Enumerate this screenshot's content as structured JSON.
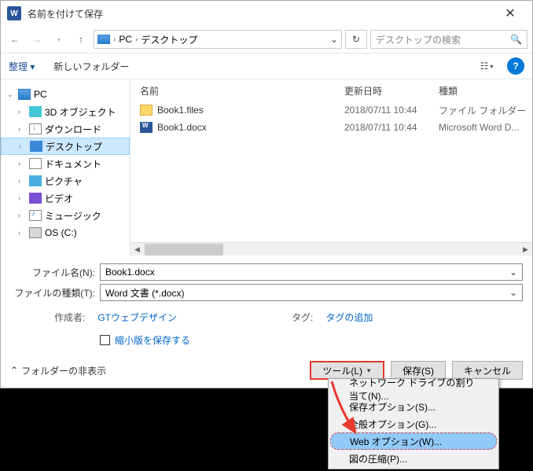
{
  "title": "名前を付けて保存",
  "breadcrumb": {
    "pc": "PC",
    "desktop": "デスクトップ"
  },
  "search": {
    "placeholder": "デスクトップの検索"
  },
  "toolbar": {
    "organize": "整理 ▾",
    "new_folder": "新しいフォルダー"
  },
  "columns": {
    "name": "名前",
    "date": "更新日時",
    "type": "種類"
  },
  "sidebar": {
    "pc": "PC",
    "items": [
      {
        "label": "3D オブジェクト"
      },
      {
        "label": "ダウンロード"
      },
      {
        "label": "デスクトップ"
      },
      {
        "label": "ドキュメント"
      },
      {
        "label": "ピクチャ"
      },
      {
        "label": "ビデオ"
      },
      {
        "label": "ミュージック"
      },
      {
        "label": "OS (C:)"
      }
    ]
  },
  "files": [
    {
      "name": "Book1.files",
      "date": "2018/07/11 10:44",
      "type": "ファイル フォルダー"
    },
    {
      "name": "Book1.docx",
      "date": "2018/07/11 10:44",
      "type": "Microsoft Word D..."
    }
  ],
  "fields": {
    "filename_label": "ファイル名(N):",
    "filename_value": "Book1.docx",
    "filetype_label": "ファイルの種類(T):",
    "filetype_value": "Word 文書 (*.docx)"
  },
  "meta": {
    "author_label": "作成者:",
    "author_value": "GTウェブデザイン",
    "tag_label": "タグ:",
    "tag_value": "タグの追加"
  },
  "thumbnail_checkbox": "縮小版を保存する",
  "footer": {
    "hide_folders": "フォルダーの非表示",
    "tools": "ツール(L)",
    "save": "保存(S)",
    "cancel": "キャンセル"
  },
  "menu": {
    "items": [
      "ネットワーク ドライブの割り当て(N)...",
      "保存オプション(S)...",
      "全般オプション(G)...",
      "Web オプション(W)...",
      "図の圧縮(P)..."
    ]
  }
}
